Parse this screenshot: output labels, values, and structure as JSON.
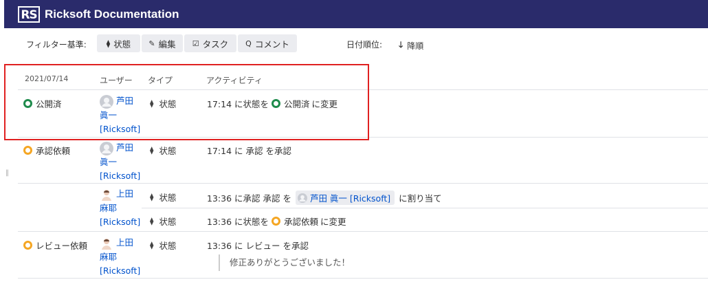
{
  "app": {
    "logo_text": "RS",
    "title": "Ricksoft Documentation"
  },
  "filters": {
    "label": "フィルター基準:",
    "buttons": [
      {
        "label": "状態",
        "icon": "diamond-status-icon"
      },
      {
        "label": "編集",
        "icon": "pencil-icon"
      },
      {
        "label": "タスク",
        "icon": "checkbox-icon"
      },
      {
        "label": "コメント",
        "icon": "comment-icon"
      }
    ],
    "sort_label": "日付順位:",
    "sort_value": "降順"
  },
  "table": {
    "headers": {
      "date": "2021/07/14",
      "user": "ユーザー",
      "type": "タイプ",
      "activity": "アクティビティ"
    },
    "rows": [
      {
        "status": "公開済",
        "status_color": "#1f8b4c",
        "user": {
          "l1": "芦田",
          "l2": "眞一",
          "l3": "[Ricksoft]"
        },
        "entries": [
          {
            "type": "状態",
            "time": "17:14 に状態を",
            "status": "公開済",
            "suffix": "に変更"
          }
        ]
      },
      {
        "status": "承認依頼",
        "status_color": "#f5a623",
        "user": {
          "l1": "芦田",
          "l2": "眞一",
          "l3": "[Ricksoft]"
        },
        "entries": [
          {
            "type": "状態",
            "text": "17:14 に 承認 を承認"
          }
        ]
      },
      {
        "status": "",
        "user": {
          "l1": "上田",
          "l2": "麻耶",
          "l3": "[Ricksoft]"
        },
        "entries": [
          {
            "type": "状態",
            "prefix": "13:36 に承認 承認 を",
            "chip": "芦田 眞一 [Ricksoft]",
            "suffix": "に割り当て"
          },
          {
            "type": "状態",
            "time": "13:36 に状態を",
            "status": "承認依頼",
            "suffix": "に変更"
          }
        ]
      },
      {
        "status": "レビュー依頼",
        "status_color": "#f5a623",
        "user": {
          "l1": "上田",
          "l2": "麻耶",
          "l3": "[Ricksoft]"
        },
        "entries": [
          {
            "type": "状態",
            "text": "13:36 に レビュー を承認",
            "comment": "修正ありがとうございました！"
          }
        ]
      }
    ]
  },
  "colors": {
    "topbar": "#2a2b6b",
    "link": "#0052cc",
    "highlight": "#e02020"
  }
}
